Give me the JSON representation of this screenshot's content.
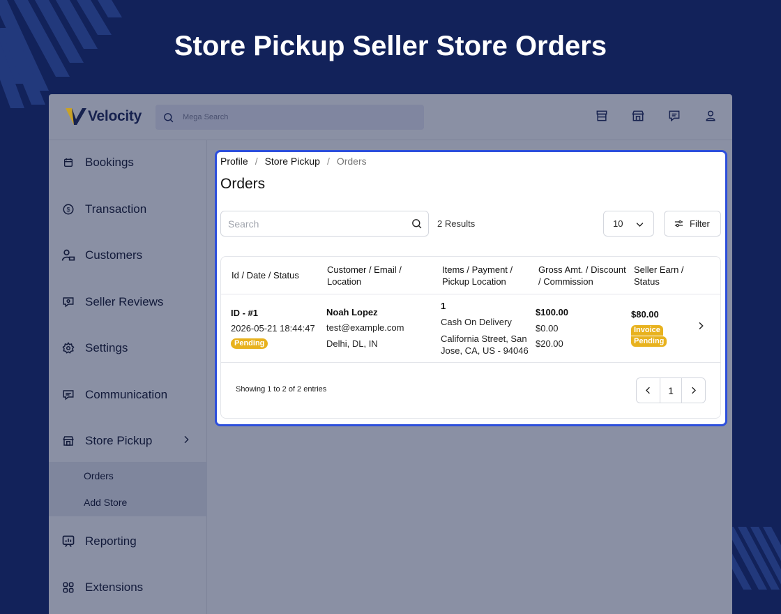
{
  "promo": {
    "title": "Store Pickup Seller Store Orders"
  },
  "header": {
    "logo_text": "Velocity",
    "search_placeholder": "Mega Search",
    "icons": [
      "storefront-icon",
      "shop-icon",
      "chat-icon",
      "user-icon"
    ]
  },
  "sidebar": {
    "items": [
      {
        "label": "Bookings",
        "icon": "calendar-icon"
      },
      {
        "label": "Transaction",
        "icon": "dollar-icon"
      },
      {
        "label": "Customers",
        "icon": "customers-icon"
      },
      {
        "label": "Seller Reviews",
        "icon": "review-icon"
      },
      {
        "label": "Settings",
        "icon": "gear-icon"
      },
      {
        "label": "Communication",
        "icon": "message-icon"
      },
      {
        "label": "Store Pickup",
        "icon": "store-icon"
      },
      {
        "label": "Reporting",
        "icon": "chart-icon"
      },
      {
        "label": "Extensions",
        "icon": "grid-icon"
      }
    ],
    "subitems": [
      "Orders",
      "Add Store"
    ]
  },
  "breadcrumb": {
    "items": [
      "Profile",
      "Store Pickup",
      "Orders"
    ],
    "separator": "/"
  },
  "page_title": "Orders",
  "toolbar": {
    "search_placeholder": "Search",
    "results": "2 Results",
    "per_page": "10",
    "filter_label": "Filter"
  },
  "table": {
    "headers": [
      [
        "Id / Date / Status"
      ],
      [
        "Customer / Email /",
        "Location"
      ],
      [
        "Items / Payment /",
        "Pickup Location"
      ],
      [
        "Gross Amt. / Discount",
        "/ Commission"
      ],
      [
        "Seller Earn /",
        "Status"
      ]
    ],
    "row": {
      "id": "ID - #1",
      "date": "2026-05-21 18:44:47",
      "status": "Pending",
      "customer": "Noah Lopez",
      "email": "test@example.com",
      "location": "Delhi, DL, IN",
      "items": "1",
      "payment": "Cash On Delivery",
      "pickup_1": "California Street, San",
      "pickup_2": "Jose, CA, US - 94046",
      "gross": "$100.00",
      "discount": "$0.00",
      "commission": "$20.00",
      "seller_earn": "$80.00",
      "invoice_status_1": "Invoice",
      "invoice_status_2": "Pending"
    }
  },
  "footer": {
    "showing": "Showing 1 to 2 of 2 entries",
    "current_page": "1"
  },
  "colors": {
    "background": "#12225a",
    "highlight_border": "#2d4fdc",
    "badge": "#e8b21e",
    "app_overlay": "#8a90a4"
  }
}
